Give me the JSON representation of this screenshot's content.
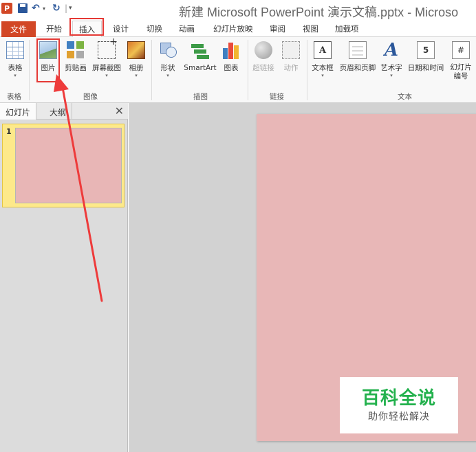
{
  "window": {
    "title": "新建 Microsoft PowerPoint 演示文稿.pptx - Microso",
    "app_icon_letter": "P"
  },
  "quick_access": {
    "undo_glyph": "↶",
    "redo_glyph": "↻",
    "dropdown_glyph": "▾",
    "separator": "|",
    "more_glyph": "▾"
  },
  "tabs": [
    {
      "label": "文件"
    },
    {
      "label": "开始"
    },
    {
      "label": "插入"
    },
    {
      "label": "设计"
    },
    {
      "label": "切换"
    },
    {
      "label": "动画"
    },
    {
      "label": "幻灯片放映"
    },
    {
      "label": "审阅"
    },
    {
      "label": "视图"
    },
    {
      "label": "加载项"
    }
  ],
  "active_tab": "插入",
  "ribbon": {
    "groups": {
      "tables": "表格",
      "images": "图像",
      "illustrations": "插图",
      "links": "链接",
      "text": "文本"
    },
    "buttons": {
      "table": "表格",
      "picture": "图片",
      "clipart": "剪贴画",
      "screenshot": "屏幕截图",
      "album": "相册",
      "shapes": "形状",
      "smartart": "SmartArt",
      "chart": "图表",
      "hyperlink": "超链接",
      "action": "动作",
      "textbox": "文本框",
      "header_footer": "页眉和页脚",
      "wordart": "艺术字",
      "datetime": "日期和时间",
      "slidenum_line1": "幻灯片",
      "slidenum_line2": "编号"
    },
    "icon_text": {
      "textbox": "A",
      "wordart": "A",
      "datetime": "5",
      "slidenum": "#"
    },
    "dropdown_glyph": "▾"
  },
  "left_pane": {
    "tabs": [
      "幻灯片",
      "大纲"
    ],
    "close_glyph": "✕",
    "slides": [
      {
        "number": "1"
      }
    ]
  },
  "watermark": {
    "title": "百科全说",
    "subtitle": "助你轻松解决"
  },
  "colors": {
    "file_tab": "#d24726",
    "slide_bg": "#e8b7b7",
    "highlight": "#e53935",
    "watermark_green": "#23b14d"
  }
}
